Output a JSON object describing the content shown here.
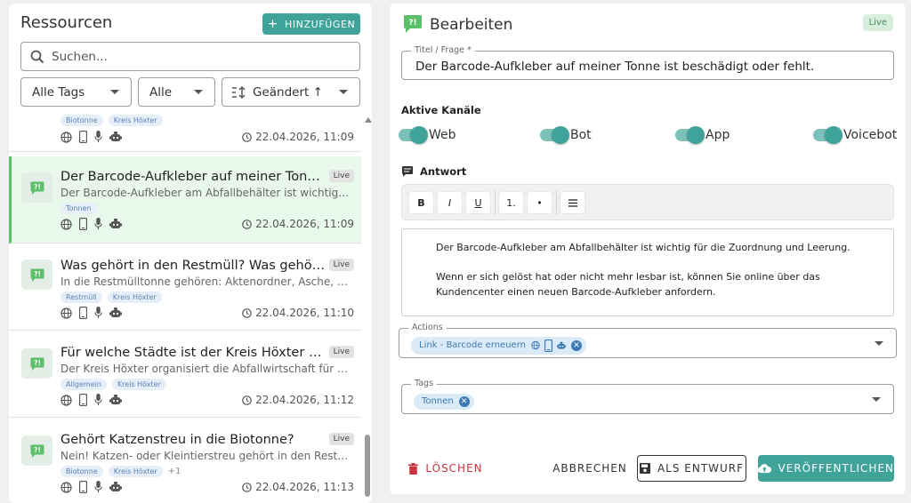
{
  "left": {
    "title": "Ressourcen",
    "add_label": "HINZUFÜGEN",
    "search_placeholder": "Suchen...",
    "filters": {
      "tags": "Alle Tags",
      "status": "Alle",
      "sort": "Geändert ↑"
    }
  },
  "items": [
    {
      "title": "",
      "subtitle": "",
      "badge": "",
      "tags": [
        "Biotonne",
        "Kreis Höxter"
      ],
      "more": "",
      "date": "22.04.2026, 11:09"
    },
    {
      "title": "Der Barcode-Aufkleber auf meiner Tonne ist …",
      "subtitle": "Der Barcode-Aufkleber am Abfallbehälter ist wichtig für…",
      "badge": "Live",
      "tags": [
        "Tonnen"
      ],
      "more": "",
      "date": "22.04.2026, 11:09"
    },
    {
      "title": "Was gehört in den Restmüll? Was gehört zu…",
      "subtitle": "In die Restmülltonne gehören: Aktenordner, Asche, Fot…",
      "badge": "Live",
      "tags": [
        "Restmüll",
        "Kreis Höxter"
      ],
      "more": "",
      "date": "22.04.2026, 11:10"
    },
    {
      "title": "Für welche Städte ist der Kreis Höxter zustän…",
      "subtitle": "Der Kreis Höxter organisiert die Abfallwirtschaft für die …",
      "badge": "Live",
      "tags": [
        "Allgemein",
        "Kreis Höxter"
      ],
      "more": "",
      "date": "22.04.2026, 11:12"
    },
    {
      "title": "Gehört Katzenstreu in die Biotonne?",
      "subtitle": "Nein! Katzen- oder Kleintierstreu gehört in den Restmül…",
      "badge": "Live",
      "tags": [
        "Biotonne",
        "Kreis Höxter"
      ],
      "more": "+1",
      "date": "22.04.2026, 11:13"
    }
  ],
  "edit": {
    "title": "Bearbeiten",
    "status": "Live",
    "title_legend": "Titel / Frage *",
    "title_value": "Der Barcode-Aufkleber auf meiner Tonne ist beschädigt oder fehlt.",
    "channels_label": "Aktive Kanäle",
    "channels": [
      "Web",
      "Bot",
      "App",
      "Voicebot"
    ],
    "answer_label": "Antwort",
    "toolbar": {
      "bold": "B",
      "italic": "I",
      "underline": "U",
      "ordered": "1.",
      "bullet": "•"
    },
    "answer_lines": [
      "Der Barcode-Aufkleber am Abfallbehälter ist wichtig für die Zuordnung und Leerung.",
      "Wenn er sich gelöst hat oder nicht mehr lesbar ist, können Sie online über das",
      "Kundencenter einen neuen Barcode-Aufkleber anfordern."
    ],
    "actions_legend": "Actions",
    "action_chip": "Link - Barcode erneuern",
    "tags_legend": "Tags",
    "tag_chip": "Tonnen",
    "delete_label": "LÖSCHEN",
    "cancel_label": "ABBRECHEN",
    "draft_label": "ALS ENTWURF",
    "publish_label": "VERÖFFENTLICHEN"
  },
  "colors": {
    "accent": "#3fa39a",
    "selected_bg": "#e8f8eb",
    "danger": "#c9333e",
    "chip": "#3d79b5"
  }
}
